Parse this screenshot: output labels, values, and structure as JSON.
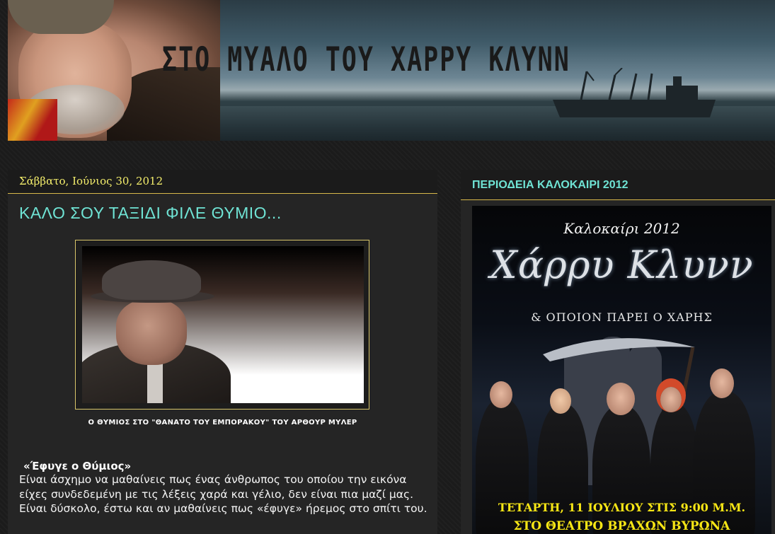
{
  "header": {
    "title": "ΣΤΟ ΜΥΑΛΟ ΤΟΥ ΧΑΡΡΥ ΚΛΥΝΝ"
  },
  "post": {
    "date": "Σάββατο, Ιούνιος 30, 2012",
    "title": "ΚΑΛΟ ΣΟΥ ΤΑΞΙΔΙ ΦΙΛΕ ΘΥΜΙΟ...",
    "caption": "Ο ΘΥΜΙΟΣ ΣΤΟ \"ΘΑΝΑΤΟ ΤΟΥ ΕΜΠΟΡΑΚΟΥ\" ΤΟΥ ΑΡΘΟΥΡ ΜΥΛΕΡ",
    "quote_title": "«Έφυγε ο Θύμιος»",
    "body": "Είναι άσχημο να μαθαίνεις πως ένας άνθρωπος του οποίου την εικόνα είχες συνδεδεμένη με τις λέξεις χαρά και γέλιο, δεν είναι πια μαζί μας. Είναι δύσκολο, έστω και αν μαθαίνεις πως «έφυγε» ήρεμος στο σπίτι του."
  },
  "sidebar": {
    "widget_title": "ΠΕΡΙΟΔΕΙΑ ΚΑΛΟΚΑΙΡΙ 2012",
    "poster": {
      "season": "Καλοκαίρι 2012",
      "name": "Χάρρυ Κλυνν",
      "subtitle": "& ΟΠΟΙΟΝ ΠΑΡΕΙ Ο ΧΑΡΗΣ",
      "line1": "ΤΕΤΑΡΤΗ, 11 ΙΟΥΛΙΟΥ ΣΤΙΣ 9:00 Μ.Μ.",
      "line2": "ΣΤΟ ΘΕΑΤΡΟ ΒΡΑΧΩΝ ΒΥΡΩΝΑ"
    }
  },
  "colors": {
    "accent_teal": "#6fe3d4",
    "date_yellow": "#f5ef6c",
    "divider_gold": "#d8b84a",
    "poster_yellow": "#f7e615"
  }
}
